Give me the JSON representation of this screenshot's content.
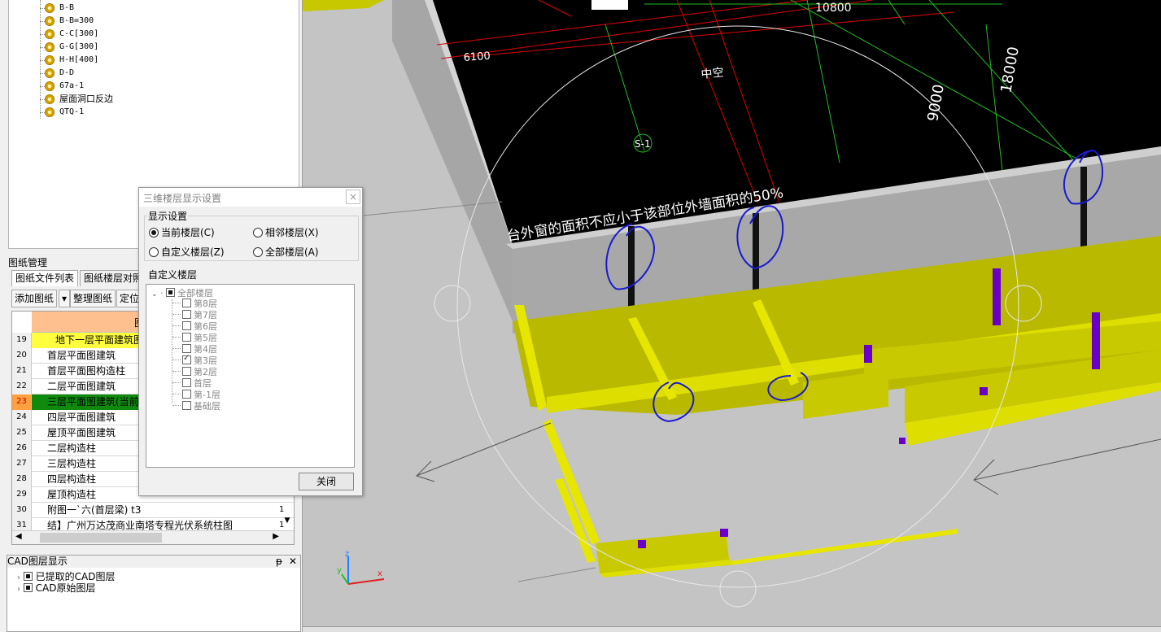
{
  "component_tree": [
    "B-B",
    "B-B=300",
    "C-C[300]",
    "G-G[300]",
    "H-H[400]",
    "D-D",
    "67a-1",
    "屋面洞口反边",
    "QTQ-1"
  ],
  "drawing_manager": {
    "title": "图纸管理",
    "tabs": [
      "图纸文件列表",
      "图纸楼层对照"
    ],
    "toolbar": {
      "add": "添加图纸",
      "dropdown": "▾",
      "organize": "整理图纸",
      "locate": "定位"
    },
    "header_fragment": "图",
    "rows": [
      {
        "num": "19",
        "name": "地下一层平面建筑图",
        "flag": ""
      },
      {
        "num": "20",
        "name": "首层平面图建筑",
        "flag": ""
      },
      {
        "num": "21",
        "name": "首层平面图构造柱",
        "flag": ""
      },
      {
        "num": "22",
        "name": "二层平面图建筑",
        "flag": ""
      },
      {
        "num": "23",
        "name": "三层平面图建筑(当前",
        "flag": ""
      },
      {
        "num": "24",
        "name": "四层平面图建筑",
        "flag": ""
      },
      {
        "num": "25",
        "name": "屋顶平面图建筑",
        "flag": ""
      },
      {
        "num": "26",
        "name": "二层构造柱",
        "flag": ""
      },
      {
        "num": "27",
        "name": "三层构造柱",
        "flag": ""
      },
      {
        "num": "28",
        "name": "四层构造柱",
        "flag": ""
      },
      {
        "num": "29",
        "name": "屋顶构造柱",
        "flag": ""
      },
      {
        "num": "30",
        "name": "附图一`六(首层梁) t3",
        "flag": "1"
      },
      {
        "num": "31",
        "name": "结】广州万达茂商业南塔专程光伏系统柱图",
        "flag": "1"
      }
    ]
  },
  "cad_panel": {
    "title": "CAD图层显示",
    "pin": "ᵽ",
    "close": "✕",
    "items": [
      "已提取的CAD图层",
      "CAD原始图层"
    ]
  },
  "dialog": {
    "title": "三维楼层显示设置",
    "close": "×",
    "display_group": "显示设置",
    "options": {
      "current": "当前楼层(C)",
      "adjacent": "相邻楼层(X)",
      "custom": "自定义楼层(Z)",
      "all": "全部楼层(A)"
    },
    "selected_option": "current",
    "custom_group": "自定义楼层",
    "floors_root": "全部楼层",
    "floors": [
      {
        "label": "第8层",
        "checked": false
      },
      {
        "label": "第7层",
        "checked": false
      },
      {
        "label": "第6层",
        "checked": false
      },
      {
        "label": "第5层",
        "checked": false
      },
      {
        "label": "第4层",
        "checked": false
      },
      {
        "label": "第3层",
        "checked": true
      },
      {
        "label": "第2层",
        "checked": false
      },
      {
        "label": "首层",
        "checked": false
      },
      {
        "label": "第-1层",
        "checked": false
      },
      {
        "label": "基础层",
        "checked": false
      }
    ],
    "close_button": "关闭"
  },
  "viewport": {
    "dims": [
      "10800",
      "6100",
      "9000",
      "18000"
    ],
    "void_label": "中空",
    "axis_label": "S-1",
    "note": "台外窗的面积不应小于该部位外墙面积的50%",
    "colors": {
      "wall_yellow": "#c8c800",
      "wall_gray": "#a8a8a8",
      "cad_black": "#000000",
      "column_purple": "#6a00c8",
      "annotation_blue": "#1a1ad0"
    }
  }
}
